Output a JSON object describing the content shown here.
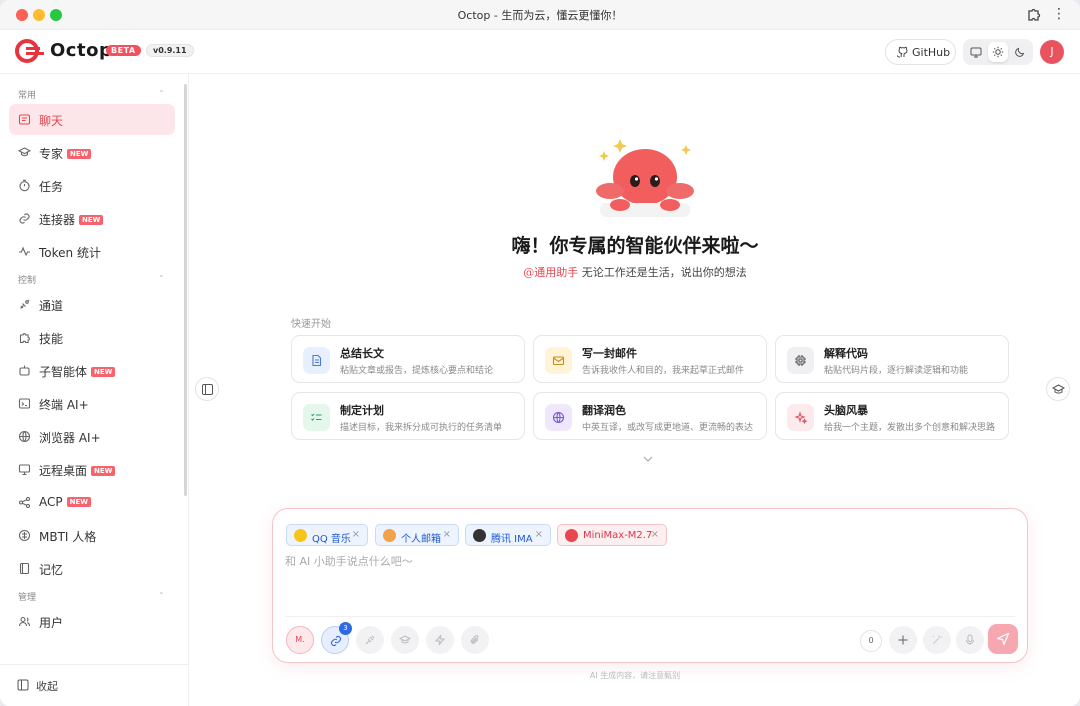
{
  "window": {
    "title": "Octop - 生而为云，懂云更懂你！"
  },
  "header": {
    "brand": "Octop",
    "beta": "BETA",
    "version": "v0.9.11",
    "github_label": "GitHub",
    "avatar_initial": "J"
  },
  "sidebar": {
    "sections": [
      {
        "label": "常用",
        "items": [
          {
            "label": "聊天",
            "icon": "chat-icon",
            "new": false,
            "active": true
          },
          {
            "label": "专家",
            "icon": "graduation-cap-icon",
            "new": true
          },
          {
            "label": "任务",
            "icon": "timer-icon",
            "new": false
          },
          {
            "label": "连接器",
            "icon": "link-icon",
            "new": true
          },
          {
            "label": "Token 统计",
            "icon": "activity-icon",
            "new": false
          }
        ]
      },
      {
        "label": "控制",
        "items": [
          {
            "label": "通道",
            "icon": "satellite-icon",
            "new": false
          },
          {
            "label": "技能",
            "icon": "puzzle-icon",
            "new": false
          },
          {
            "label": "子智能体",
            "icon": "bot-icon",
            "new": true
          },
          {
            "label": "终端 AI+",
            "icon": "terminal-icon",
            "new": false
          },
          {
            "label": "浏览器 AI+",
            "icon": "globe-icon",
            "new": false
          },
          {
            "label": "远程桌面",
            "icon": "monitor-icon",
            "new": true
          },
          {
            "label": "ACP",
            "icon": "share-icon",
            "new": true
          },
          {
            "label": "MBTI 人格",
            "icon": "brain-icon",
            "new": false
          },
          {
            "label": "记忆",
            "icon": "book-icon",
            "new": false
          }
        ]
      },
      {
        "label": "管理",
        "items": [
          {
            "label": "用户",
            "icon": "users-icon",
            "new": false
          }
        ]
      }
    ],
    "new_badge": "NEW",
    "collapse_label": "收起"
  },
  "hero": {
    "title": "嗨！你专属的智能伙伴来啦～",
    "mention": "@通用助手",
    "subtitle": "无论工作还是生活，说出你的想法"
  },
  "quick_start": {
    "label": "快速开始",
    "cards": [
      {
        "title": "总结长文",
        "desc": "粘贴文章或报告，提炼核心要点和结论",
        "icon": "document-icon",
        "tint": "#e8f0ff",
        "color": "#4a7bd8"
      },
      {
        "title": "写一封邮件",
        "desc": "告诉我收件人和目的，我来起草正式邮件",
        "icon": "mail-icon",
        "tint": "#fff4d6",
        "color": "#c98a16"
      },
      {
        "title": "解释代码",
        "desc": "粘贴代码片段，逐行解读逻辑和功能",
        "icon": "cpu-icon",
        "tint": "#f0f0f3",
        "color": "#555"
      },
      {
        "title": "制定计划",
        "desc": "描述目标，我来拆分成可执行的任务清单",
        "icon": "checklist-icon",
        "tint": "#e3f7ea",
        "color": "#2f9e5a"
      },
      {
        "title": "翻译润色",
        "desc": "中英互译，或改写成更地道、更流畅的表达",
        "icon": "globe-icon",
        "tint": "#efe8fd",
        "color": "#7a55d6"
      },
      {
        "title": "头脑风暴",
        "desc": "给我一个主题，发散出多个创意和解决思路",
        "icon": "sparkles-icon",
        "tint": "#fdeaec",
        "color": "#e0525f"
      }
    ]
  },
  "composer": {
    "chips": [
      {
        "label": "QQ 音乐",
        "style": "blue",
        "icon": "qq-music-icon",
        "icon_color": "#f5c518"
      },
      {
        "label": "个人邮箱",
        "style": "blue",
        "icon": "mailbox-icon",
        "icon_color": "#f0a14a"
      },
      {
        "label": "腾讯 IMA",
        "style": "blue",
        "icon": "panda-icon",
        "icon_color": "#333333"
      },
      {
        "label": "MiniMax-M2.7",
        "style": "red",
        "icon": "minimax-icon",
        "icon_color": "#e8474f"
      }
    ],
    "placeholder": "和 AI 小助手说点什么吧～",
    "model_short": "M.",
    "link_badge": "3",
    "token_count": "0",
    "close_glyph": "×"
  },
  "disclaimer": "AI 生成内容，请注意甄别",
  "colors": {
    "accent": "#e8474f",
    "accent_soft": "#fde6e9",
    "link_blue": "#2f68e8"
  }
}
